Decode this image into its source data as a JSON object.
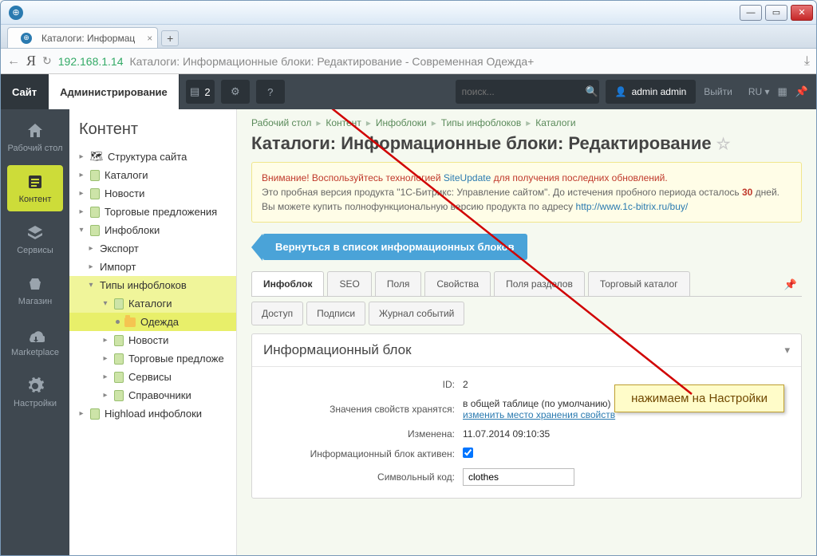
{
  "browser": {
    "tab_title": "Каталоги: Информац",
    "address_ip": "192.168.1.14",
    "address_title": "Каталоги: Информационные блоки: Редактирование - Современная Одежда+"
  },
  "adminbar": {
    "site": "Сайт",
    "admin": "Администрирование",
    "notif_count": "2",
    "search_placeholder": "поиск...",
    "user": "admin admin",
    "logout": "Выйти",
    "lang": "RU"
  },
  "rail": {
    "items": [
      {
        "label": "Рабочий стол"
      },
      {
        "label": "Контент"
      },
      {
        "label": "Сервисы"
      },
      {
        "label": "Магазин"
      },
      {
        "label": "Marketplace"
      },
      {
        "label": "Настройки"
      }
    ]
  },
  "tree": {
    "title": "Контент",
    "items": [
      {
        "label": "Структура сайта"
      },
      {
        "label": "Каталоги"
      },
      {
        "label": "Новости"
      },
      {
        "label": "Торговые предложения"
      },
      {
        "label": "Инфоблоки"
      },
      {
        "label": "Экспорт"
      },
      {
        "label": "Импорт"
      },
      {
        "label": "Типы инфоблоков"
      },
      {
        "label": "Каталоги"
      },
      {
        "label": "Одежда"
      },
      {
        "label": "Новости"
      },
      {
        "label": "Торговые предложе"
      },
      {
        "label": "Сервисы"
      },
      {
        "label": "Справочники"
      },
      {
        "label": "Highload инфоблоки"
      }
    ]
  },
  "breadcrumbs": [
    "Рабочий стол",
    "Контент",
    "Инфоблоки",
    "Типы инфоблоков",
    "Каталоги"
  ],
  "page_title": "Каталоги: Информационные блоки: Редактирование",
  "notice": {
    "warn_prefix": "Внимание! Воспользуйтесь технологией ",
    "link1": "SiteUpdate",
    "warn_suffix": " для получения последних обновлений.",
    "line2a": "Это пробная версия продукта \"1С-Битрикс: Управление сайтом\". До истечения пробного периода осталось ",
    "days": "30",
    "line2b": " дней. Вы можете купить полнофункциональную версию продукта по адресу ",
    "link2": "http://www.1c-bitrix.ru/buy/"
  },
  "back_button": "Вернуться в список информационных блоков",
  "tabs1": [
    "Инфоблок",
    "SEO",
    "Поля",
    "Свойства",
    "Поля разделов",
    "Торговый каталог"
  ],
  "tabs2": [
    "Доступ",
    "Подписи",
    "Журнал событий"
  ],
  "panel": {
    "heading": "Информационный блок",
    "rows": {
      "id_label": "ID:",
      "id_val": "2",
      "storage_label": "Значения свойств хранятся:",
      "storage_val": "в общей таблице (по умолчанию)",
      "storage_link": "изменить место хранения свойств",
      "modified_label": "Изменена:",
      "modified_val": "11.07.2014 09:10:35",
      "active_label": "Информационный блок активен:",
      "code_label": "Символьный код:",
      "code_val": "clothes"
    }
  },
  "callout": "нажимаем на Настройки"
}
